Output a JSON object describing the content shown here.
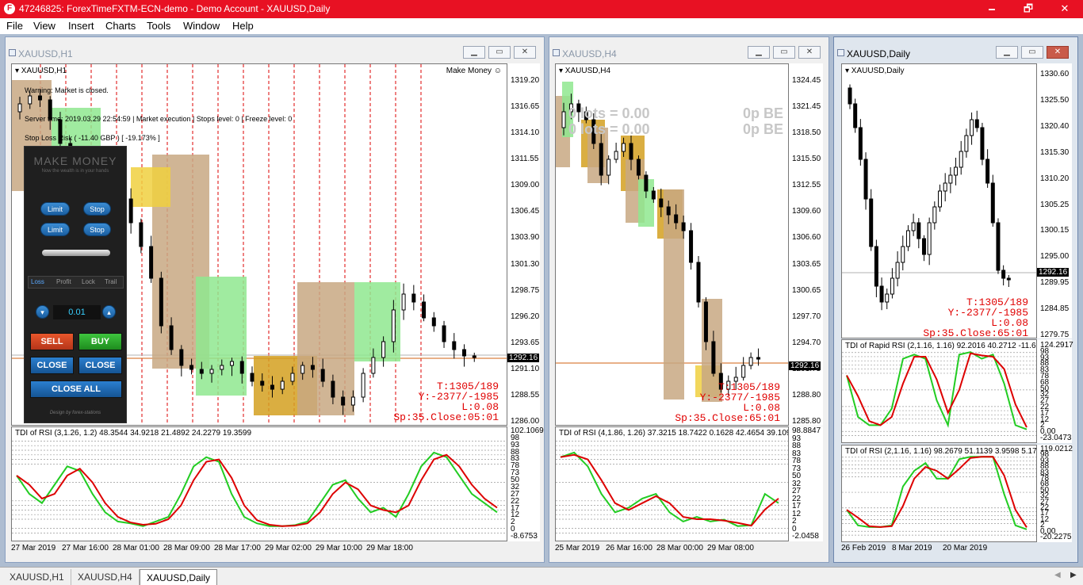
{
  "window": {
    "title": "47246825: ForexTimeFXTM-ECN-demo - Demo Account - XAUUSD,Daily",
    "minimize": "🗕",
    "restore": "🗗",
    "close": "✕"
  },
  "menu": [
    "File",
    "View",
    "Insert",
    "Charts",
    "Tools",
    "Window",
    "Help"
  ],
  "charts": {
    "h1": {
      "window_title": "XAUUSD,H1",
      "symbol_label": "▾ XAUUSD,H1",
      "ea_name": "Make Money ☺",
      "info1": "Warning: Market is closed.",
      "info2": "Server time: 2019.03.29 22:54:59  | Market execution  | Stops level: 0  | Freeze level: 0",
      "info3": "Stop Loss  Risk ( -11.40 GBP ) [ -19.173% ]",
      "price_ticks": [
        "1319.20",
        "1316.65",
        "1314.10",
        "1311.55",
        "1309.00",
        "1306.45",
        "1303.90",
        "1301.30",
        "1298.75",
        "1296.20",
        "1293.65",
        "1291.10",
        "1288.55",
        "1286.00"
      ],
      "current_price": "1292.16",
      "red_text": [
        "T:1305/189",
        "Y:-2377/-1985",
        "L:0.08",
        "Sp:35.Close:05:01"
      ],
      "indicator_label": "TDI of RSI  (3,1.26, 1.2) 48.3544 34.9218 21.4892 24.2279 19.3599",
      "ind_ticks": [
        "102.1069",
        "98",
        "93",
        "88",
        "83",
        "78",
        "73",
        "50",
        "32",
        "27",
        "22",
        "17",
        "12",
        "2",
        "0",
        "-8.6753"
      ],
      "time_ticks": [
        "27 Mar 2019",
        "27 Mar 16:00",
        "28 Mar 01:00",
        "28 Mar 09:00",
        "28 Mar 17:00",
        "29 Mar 02:00",
        "29 Mar 10:00",
        "29 Mar 18:00"
      ]
    },
    "h4": {
      "window_title": "XAUUSD,H4",
      "symbol_label": "▾ XAUUSD,H4",
      "gray_left": [
        "0 lots = 0.00",
        "0 lots = 0.00"
      ],
      "gray_right": [
        "0p BE",
        "0p BE"
      ],
      "price_ticks": [
        "1324.45",
        "1321.45",
        "1318.50",
        "1315.50",
        "1312.55",
        "1309.60",
        "1306.60",
        "1303.65",
        "1300.65",
        "1297.70",
        "1294.70",
        "1291.75",
        "1288.80",
        "1285.80"
      ],
      "current_price": "1292.16",
      "red_text": [
        "T:1305/189",
        "Y:-2377/-1985",
        "L:0.08",
        "Sp:35.Close:65:01"
      ],
      "indicator_label": "TDI of RSI  (4,1.86, 1.26) 37.3215 18.7422 0.1628 42.4654 39.1090",
      "ind_ticks": [
        "98.8847",
        "93",
        "88",
        "83",
        "78",
        "73",
        "50",
        "32",
        "27",
        "22",
        "17",
        "12",
        "2",
        "0",
        "-2.0458"
      ],
      "time_ticks": [
        "25 Mar 2019",
        "26 Mar 16:00",
        "28 Mar 00:00",
        "29 Mar 08:00"
      ]
    },
    "daily": {
      "window_title": "XAUUSD,Daily",
      "symbol_label": "▾ XAUUSD,Daily",
      "price_ticks": [
        "1330.60",
        "1325.50",
        "1320.40",
        "1315.30",
        "1310.20",
        "1305.25",
        "1300.15",
        "1295.00",
        "1289.95",
        "1284.85",
        "1279.75"
      ],
      "current_price": "1292.16",
      "red_text": [
        "T:1305/189",
        "Y:-2377/-1985",
        "L:0.08",
        "Sp:35.Close:65:01"
      ],
      "ind1_label": "TDI of Rapid RSI  (2,1.16, 1.16) 92.2016 40.2712 -11.6593",
      "ind1_ticks": [
        "124.2917",
        "98",
        "93",
        "88",
        "83",
        "78",
        "68",
        "50",
        "32",
        "27",
        "22",
        "17",
        "12",
        "2",
        "0.00",
        "-23.0473"
      ],
      "ind2_label": "TDI of RSI  (2,1.16, 1.16) 98.2679 51.1139 3.9598 5.1741",
      "ind2_ticks": [
        "119.0212",
        "98",
        "93",
        "88",
        "83",
        "78",
        "68",
        "50",
        "32",
        "27",
        "22",
        "17",
        "12",
        "2",
        "0.00",
        "-20.2275"
      ],
      "time_ticks": [
        "26 Feb 2019",
        "8 Mar 2019",
        "20 Mar 2019"
      ]
    }
  },
  "panel": {
    "title": "MAKE MONEY",
    "subtitle": "Now the wealth is in your hands",
    "limit1": "Limit",
    "stop1": "Stop",
    "limit2": "Limit",
    "stop2": "Stop",
    "tabs": [
      "Loss",
      "Profit",
      "Lock",
      "Trail"
    ],
    "lot": "0.01",
    "sell": "SELL",
    "buy": "BUY",
    "close1": "CLOSE",
    "close2": "CLOSE",
    "close_all": "CLOSE ALL",
    "footer": "Design by forex-stations"
  },
  "tabs": [
    "XAUUSD,H1",
    "XAUUSD,H4",
    "XAUUSD,Daily"
  ],
  "colors": {
    "titlebar": "#e81123",
    "bull": "#ffffff",
    "bear": "#000000",
    "rsi_green": "#22cc22",
    "rsi_red": "#dd0000",
    "box_tan": "#c8a882",
    "box_green": "#8fe88f",
    "box_gold": "#d4a020"
  }
}
